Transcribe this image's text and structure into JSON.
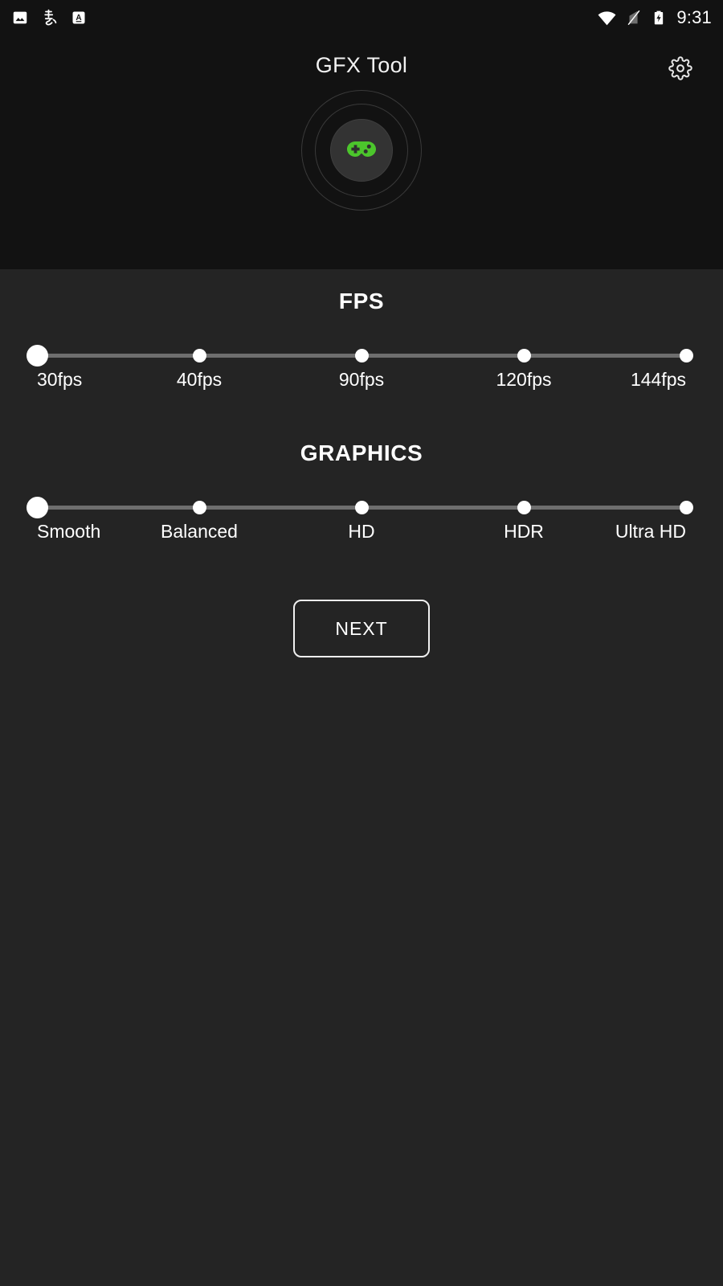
{
  "status_bar": {
    "left_icons": [
      {
        "name": "image-icon",
        "label": "image"
      },
      {
        "name": "chinese-input-icon",
        "label": "虫"
      },
      {
        "name": "keyboard-language-icon",
        "label": "A"
      }
    ],
    "right_icons": [
      {
        "name": "wifi-icon",
        "label": "wifi"
      },
      {
        "name": "mobile-signal-off-icon",
        "label": "no-signal"
      },
      {
        "name": "battery-charging-icon",
        "label": "battery-charging"
      }
    ],
    "clock": "9:31"
  },
  "header": {
    "title": "GFX Tool",
    "settings_icon": "gear-icon",
    "logo_icon": "gamepad-icon",
    "accent_color": "#4CC62C",
    "background_color": "#121212"
  },
  "main": {
    "background_color": "#242424",
    "fps": {
      "title": "FPS",
      "selected_index": 0,
      "options": [
        {
          "label": "30fps",
          "value": 30
        },
        {
          "label": "40fps",
          "value": 40
        },
        {
          "label": "90fps",
          "value": 90
        },
        {
          "label": "120fps",
          "value": 120
        },
        {
          "label": "144fps",
          "value": 144
        }
      ]
    },
    "graphics": {
      "title": "GRAPHICS",
      "selected_index": 0,
      "options": [
        {
          "label": "Smooth"
        },
        {
          "label": "Balanced"
        },
        {
          "label": "HD"
        },
        {
          "label": "HDR"
        },
        {
          "label": "Ultra HD"
        }
      ]
    },
    "next_button": "NEXT"
  }
}
